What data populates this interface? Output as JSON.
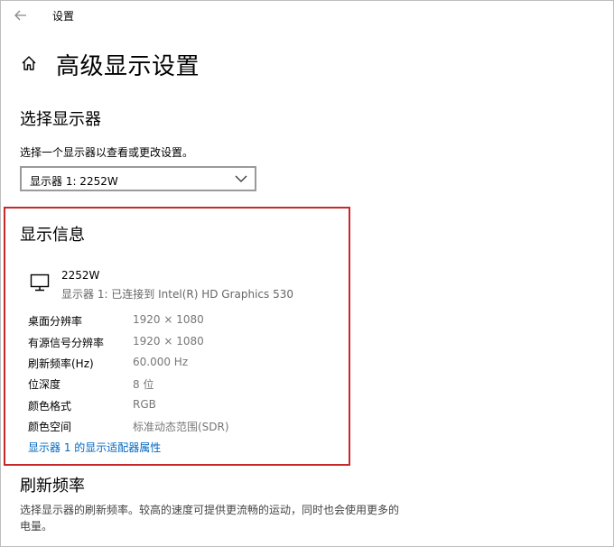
{
  "window": {
    "title": "设置"
  },
  "page": {
    "title": "高级显示设置"
  },
  "select_display": {
    "heading": "选择显示器",
    "description": "选择一个显示器以查看或更改设置。",
    "selected": "显示器 1: 2252W"
  },
  "display_info": {
    "heading": "显示信息",
    "monitor_name": "2252W",
    "monitor_subtitle": "显示器 1: 已连接到 Intel(R) HD Graphics 530",
    "rows": [
      {
        "label": "桌面分辨率",
        "value": "1920 × 1080"
      },
      {
        "label": "有源信号分辨率",
        "value": "1920 × 1080"
      },
      {
        "label": "刷新频率(Hz)",
        "value": "60.000 Hz"
      },
      {
        "label": "位深度",
        "value": "8 位"
      },
      {
        "label": "颜色格式",
        "value": "RGB"
      },
      {
        "label": "颜色空间",
        "value": "标准动态范围(SDR)"
      }
    ],
    "adapter_link": "显示器 1 的显示适配器属性"
  },
  "refresh_rate": {
    "heading": "刷新频率",
    "description": "选择显示器的刷新频率。较高的速度可提供更流畅的运动，同时也会使用更多的电量。"
  },
  "colors": {
    "highlight_border": "#c7282a",
    "link": "#0067c0"
  },
  "icons": [
    "back-arrow-icon",
    "home-icon",
    "chevron-down-icon",
    "monitor-icon"
  ]
}
